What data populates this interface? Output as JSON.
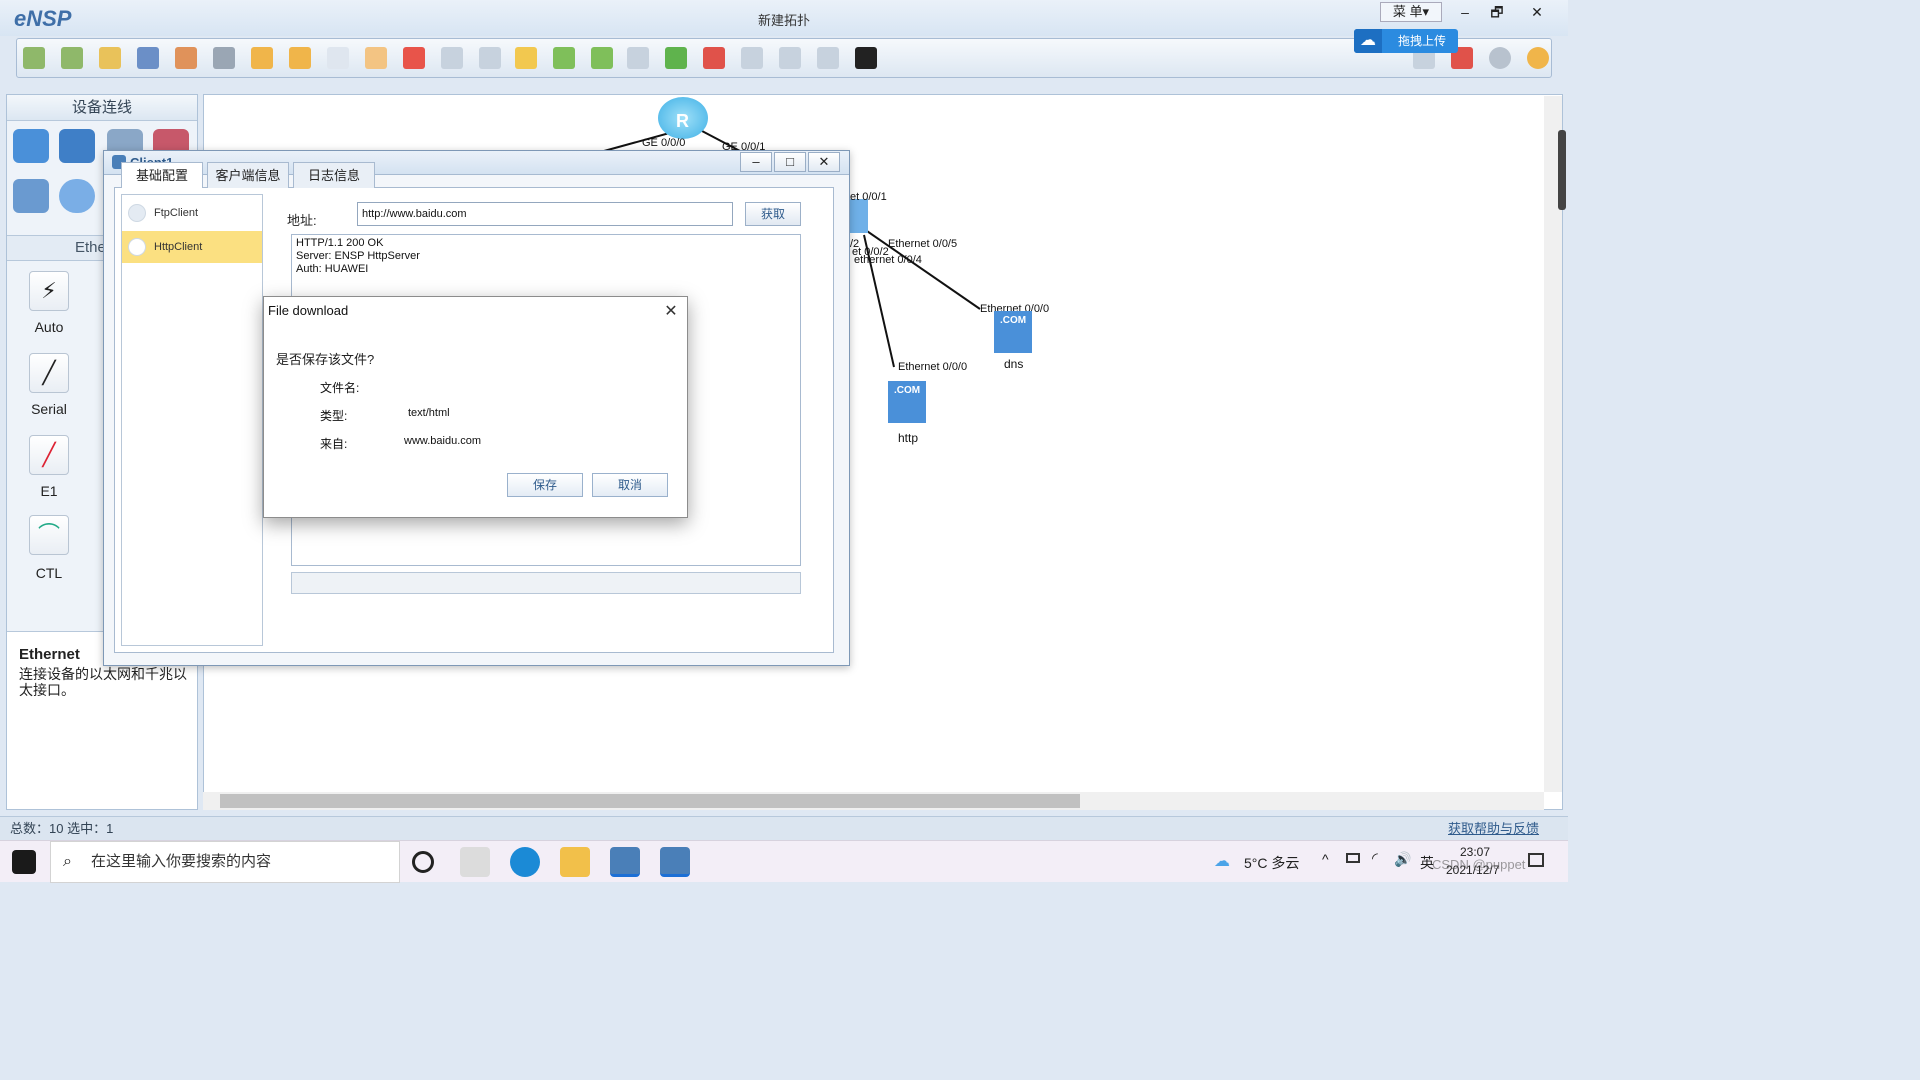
{
  "app": {
    "logo": "eNSP",
    "title": "新建拓扑",
    "menu_label": "菜 单▾",
    "upload_label": "拖拽上传"
  },
  "window_controls": {
    "minimize": "–",
    "restore": "🗗",
    "close": "✕"
  },
  "left_panel": {
    "header": "设备连线",
    "section_label": "Ethe",
    "cables": [
      {
        "label": "Auto",
        "icon": "⚡"
      },
      {
        "label": "Serial",
        "icon": "╱"
      },
      {
        "label": "E1",
        "icon": "╱"
      },
      {
        "label": "CTL",
        "icon": "⌒"
      }
    ],
    "description_title": "Ethernet",
    "description_text": "连接设备的以太网和千兆以太接口。"
  },
  "topology": {
    "port_labels": [
      "GE 0/0/0",
      "GE 0/0/1",
      "et 0/0/1",
      "Ethernet 0/0/5",
      "/2",
      "et 0/0/2",
      "ethernet 0/0/4",
      "Ethernet 0/0/0",
      "Ethernet 0/0/0"
    ],
    "devices": [
      {
        "name": "dns",
        "badge": ".COM"
      },
      {
        "name": "http",
        "badge": ".COM"
      }
    ],
    "router_letter": "R"
  },
  "status": {
    "left": "总数：10 选中：1",
    "right": "获取帮助与反馈"
  },
  "client": {
    "title": "Client1",
    "tabs": [
      "基础配置",
      "客户端信息",
      "日志信息"
    ],
    "list": [
      {
        "label": "FtpClient"
      },
      {
        "label": "HttpClient"
      }
    ],
    "address_label": "地址:",
    "address_value": "http://www.baidu.com",
    "get_button": "获取",
    "response_lines": [
      "HTTP/1.1 200 OK",
      "Server: ENSP HttpServer",
      "Auth: HUAWEI"
    ]
  },
  "file_download": {
    "title": "File download",
    "close": "✕",
    "question": "是否保存该文件?",
    "filename_label": "文件名:",
    "filename_value": "",
    "type_label": "类型:",
    "type_value": "text/html",
    "from_label": "来自:",
    "from_value": "www.baidu.com",
    "save_button": "保存",
    "cancel_button": "取消"
  },
  "taskbar": {
    "search_placeholder": "在这里输入你要搜索的内容",
    "weather": "5°C 多云",
    "ime": "英",
    "time": "23:07",
    "date": "2021/12/7",
    "watermark": "CSDN @puppet"
  },
  "colors": {
    "accent": "#2b8be0",
    "selected_item": "#fbe081",
    "device_blue": "#4a90d9"
  }
}
